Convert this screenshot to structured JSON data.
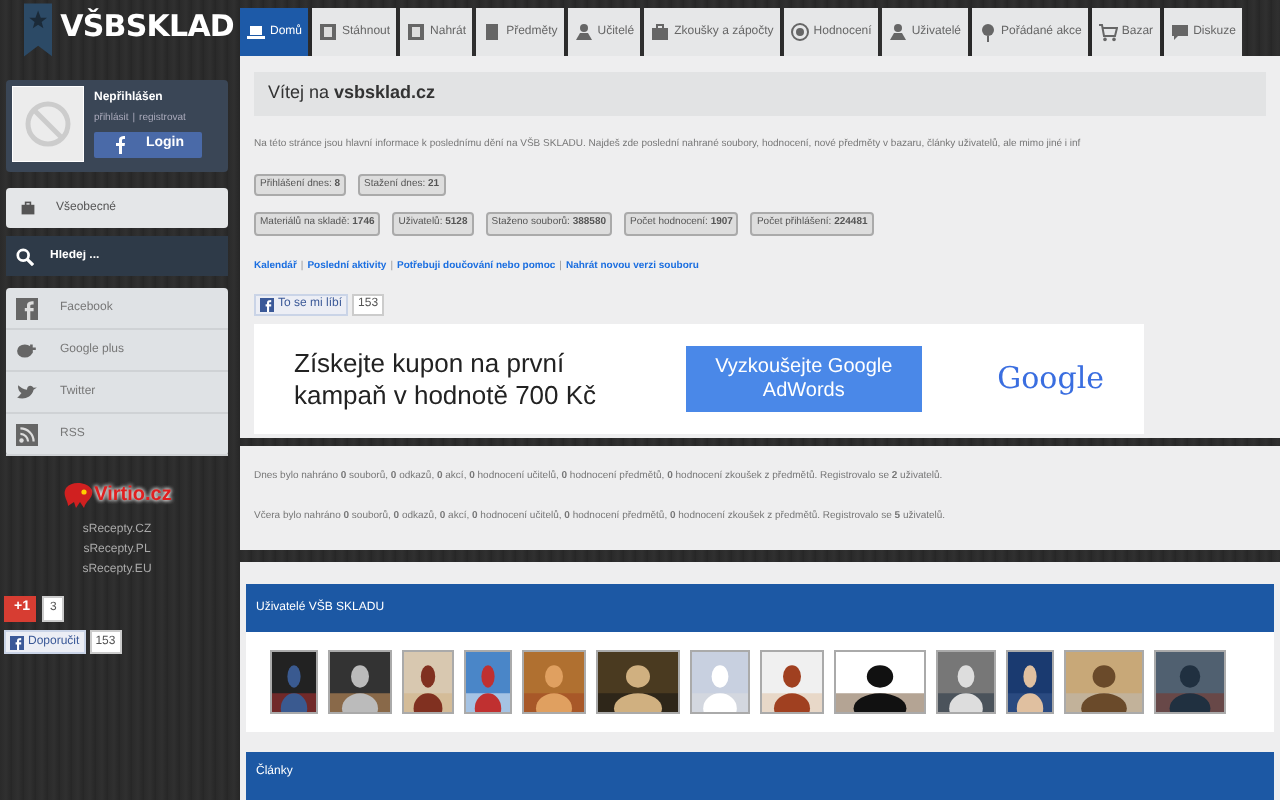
{
  "sidebar": {
    "logo": "VŠBSKLAD",
    "user": {
      "status": "Nepřihlášen",
      "login_link": "přihlásit",
      "separator": "|",
      "register_link": "registrovat",
      "login_button": "Login"
    },
    "general_button": "Všeobecné",
    "search": {
      "placeholder": "Hledej ..."
    },
    "social": [
      {
        "kind": "facebook",
        "label": "Facebook"
      },
      {
        "kind": "google",
        "label": "Google plus"
      },
      {
        "kind": "twitter",
        "label": "Twitter"
      },
      {
        "kind": "rss",
        "label": "RSS"
      }
    ],
    "partner_logo": "Virtio.cz",
    "partner_links": [
      "sRecepty.CZ",
      "sRecepty.PL",
      "sRecepty.EU"
    ],
    "plus_one": {
      "label": "+1",
      "count": "3"
    },
    "recommend": {
      "label": "Doporučit",
      "count": "153"
    }
  },
  "tabs": [
    {
      "label": "Domů",
      "selected": true
    },
    {
      "label": "Stáhnout",
      "selected": false
    },
    {
      "label": "Nahrát",
      "selected": false
    },
    {
      "label": "Předměty",
      "selected": false
    },
    {
      "label": "Učitelé",
      "selected": false
    },
    {
      "label": "Zkoušky a zápočty",
      "selected": false
    },
    {
      "label": "Hodnocení",
      "selected": false
    },
    {
      "label": "Uživatelé",
      "selected": false
    },
    {
      "label": "Pořádané akce",
      "selected": false
    },
    {
      "label": "Bazar",
      "selected": false
    },
    {
      "label": "Diskuze",
      "selected": false
    }
  ],
  "welcome": {
    "title": "Vítej na **vsbsklad.cz**",
    "intro": "Na této stránce jsou hlavní informace k poslednímu dění na VŠB SKLADU. Najdeš zde poslední nahrané soubory, hodnocení, nové předměty v bazaru, články uživatelů, ale mimo jiné i inf",
    "stats_today": [
      "Přihlášení dnes: **8**",
      "Stažení dnes: **21**"
    ],
    "stats_total": [
      "Materiálů na skladě: **1746**",
      "Uživatelů: **5128**",
      "Staženo souborů: **388580**",
      "Počet hodnocení: **1907**",
      "Počet přihlášení: **224481**"
    ],
    "link_separator": "|",
    "links": [
      "Kalendář",
      "Poslední aktivity",
      "Potřebuji doučování nebo pomoc",
      "Nahrát novou verzi souboru"
    ],
    "like": {
      "label": "To se mi líbí",
      "count": "153"
    },
    "ad": {
      "text": "Získejte kupon na první kampaň v hodnotě 700 Kč",
      "button": "Vyzkoušejte Google AdWords",
      "brand": "Google"
    }
  },
  "activity": [
    "Dnes bylo nahráno **0** souborů, **0** odkazů, **0** akcí, **0** hodnocení učitelů, **0** hodnocení předmětů, **0** hodnocení zkoušek z předmětů. Registrovalo se **2** uživatelů.",
    "Včera bylo nahráno **0** souborů, **0** odkazů, **0** akcí, **0** hodnocení učitelů, **0** hodnocení předmětů, **0** hodnocení zkoušek z předmětů. Registrovalo se **5** uživatelů."
  ],
  "users_section": {
    "title": "Uživatelé VŠB SKLADU"
  },
  "articles_section": {
    "title": "Články"
  }
}
